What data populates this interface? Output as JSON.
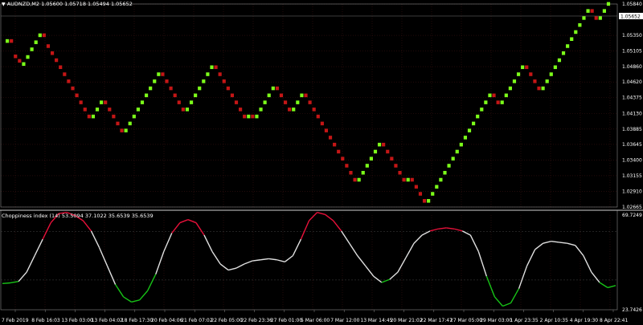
{
  "colors": {
    "background": "#000000",
    "grid": "#3a1212",
    "axis": "#ffffff",
    "bull": "#7cff1a",
    "bear": "#c41616",
    "line": "#e0e0e0",
    "low": "#17c217",
    "high": "#e8113a",
    "band": "#9a9a9a",
    "priceBox": "#ffffff"
  },
  "header": {
    "symbol_label": "AUDNZD,M2",
    "ohlc": "1.05600 1.05718 1.05494 1.05652",
    "indicator_label": "Choppiness index (14) 53.5094 37.1022 35.6539 35.6539"
  },
  "chart_data": [
    {
      "type": "renko",
      "series": "AUDNZD,M2",
      "last_price": "1.05652",
      "ylim": [
        1.02665,
        1.0584
      ],
      "y_tick_labels": [
        "1.05840",
        "1.05350",
        "1.05105",
        "1.04860",
        "1.04620",
        "1.04375",
        "1.04130",
        "1.03885",
        "1.03645",
        "1.03400",
        "1.03155",
        "1.02910",
        "1.02665"
      ],
      "brick_size": 0.00057,
      "brick_tops": [
        1.0529,
        1.0505,
        1.0498,
        1.0488,
        1.0493,
        1.0504,
        1.0516,
        1.0527,
        1.0538,
        1.0521,
        1.051,
        1.0499,
        1.0488,
        1.0477,
        1.0466,
        1.0455,
        1.0444,
        1.0433,
        1.0422,
        1.0411,
        1.04,
        1.0411,
        1.0422,
        1.0433,
        1.0422,
        1.0411,
        1.04,
        1.0389,
        1.0378,
        1.0389,
        1.04,
        1.0411,
        1.0422,
        1.0433,
        1.0444,
        1.0455,
        1.0466,
        1.0477,
        1.0466,
        1.0455,
        1.0444,
        1.0433,
        1.0422,
        1.0411,
        1.0422,
        1.0433,
        1.0444,
        1.0455,
        1.0466,
        1.0477,
        1.0488,
        1.0477,
        1.0466,
        1.0455,
        1.0444,
        1.0433,
        1.0422,
        1.0411,
        1.04,
        1.0411,
        1.04,
        1.0411,
        1.0422,
        1.0433,
        1.0444,
        1.0455,
        1.0444,
        1.0433,
        1.0422,
        1.0411,
        1.0422,
        1.0433,
        1.0444,
        1.0433,
        1.0422,
        1.0411,
        1.04,
        1.0389,
        1.0378,
        1.0367,
        1.0356,
        1.0345,
        1.0334,
        1.0323,
        1.0312,
        1.0301,
        1.0312,
        1.0323,
        1.0334,
        1.0345,
        1.0356,
        1.0367,
        1.0356,
        1.0345,
        1.0334,
        1.0323,
        1.0312,
        1.0301,
        1.0312,
        1.0301,
        1.029,
        1.0279,
        1.0268,
        1.0279,
        1.029,
        1.0301,
        1.0312,
        1.0323,
        1.0334,
        1.0345,
        1.0356,
        1.0367,
        1.0378,
        1.0389,
        1.04,
        1.0411,
        1.0422,
        1.0433,
        1.0444,
        1.0433,
        1.0422,
        1.0433,
        1.0444,
        1.0455,
        1.0466,
        1.0477,
        1.0488,
        1.0477,
        1.0466,
        1.0455,
        1.0444,
        1.0455,
        1.0466,
        1.0477,
        1.0488,
        1.0499,
        1.051,
        1.0521,
        1.0532,
        1.0543,
        1.0554,
        1.0565,
        1.0576,
        1.0565,
        1.0554,
        1.0565,
        1.0576,
        1.0587
      ]
    },
    {
      "type": "line",
      "series": "Choppiness index (14)",
      "ylim": [
        23.7426,
        69.7249
      ],
      "y_tick_labels": [
        "69.7249",
        "23.7426"
      ],
      "levels": [
        61.8,
        38.2
      ],
      "values": [
        36.5,
        36.8,
        37.5,
        42,
        50,
        58,
        66,
        70.5,
        71,
        69.5,
        67,
        62,
        54,
        45,
        36,
        30,
        27.5,
        28.5,
        33,
        41,
        52,
        61,
        66,
        67.5,
        66,
        60,
        52,
        46,
        43,
        44,
        46,
        47.5,
        48,
        48.5,
        48,
        47,
        50,
        58,
        67,
        71,
        70,
        67,
        62,
        56,
        50,
        45,
        40,
        37,
        38.5,
        42,
        49,
        56,
        60,
        62,
        63,
        63.5,
        63,
        62,
        60,
        52,
        40,
        30,
        25.5,
        27,
        34,
        45,
        53,
        56,
        57,
        56.5,
        56,
        55,
        50,
        42,
        37,
        34.5,
        35.5
      ],
      "x_labels": [
        "7 Feb 2019",
        "8 Feb 16:03",
        "13 Feb 03:00",
        "13 Feb 04:02",
        "18 Feb 17:30",
        "20 Feb 04:06",
        "21 Feb 07:02",
        "22 Feb 05:00",
        "22 Feb 23:36",
        "27 Feb 01:00",
        "5 Mar 06:00",
        "7 Mar 12:00",
        "13 Mar 14:45",
        "20 Mar 21:02",
        "22 Mar 17:47",
        "27 Mar 05:00",
        "29 Mar 03:00",
        "1 Apr 23:35",
        "2 Apr 10:35",
        "4 Apr 19:30",
        "8 Apr 22:41"
      ]
    }
  ]
}
